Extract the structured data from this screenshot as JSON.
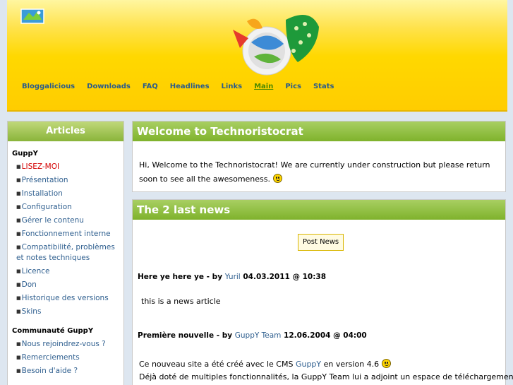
{
  "header": {
    "nav": [
      "Bloggalicious",
      "Downloads",
      "FAQ",
      "Headlines",
      "Links",
      "Main",
      "Pics",
      "Stats"
    ],
    "active_nav": "Main"
  },
  "sidebar": {
    "title": "Articles",
    "sections": [
      {
        "title": "GuppY",
        "items": [
          "LISEZ-MOI",
          "Présentation",
          "Installation",
          "Configuration",
          "Gérer le contenu",
          "Fonctionnement interne",
          "Compatibilité, problèmes et notes techniques",
          "Licence",
          "Don",
          "Historique des versions",
          "Skins"
        ]
      },
      {
        "title": "Communauté GuppY",
        "items": [
          "Nous rejoindrez-vous ?",
          "Remerciements",
          "Besoin d'aide ?"
        ]
      }
    ]
  },
  "welcome": {
    "title": "Welcome to Technoristocrat",
    "text": "Hi, Welcome to the Technoristocrat! We are currently under construction but please return soon to see all the awesomeness."
  },
  "news": {
    "title": "The 2 last news",
    "post_button": "Post News",
    "items": [
      {
        "headline": "Here ye here ye - by",
        "author": "Yuril",
        "date": "04.03.2011 @ 10:38",
        "body": "this is a news article"
      },
      {
        "headline": "Première nouvelle - by",
        "author": "GuppY Team",
        "date": "12.06.2004 @ 04:00",
        "body_pre": "Ce nouveau site a été créé avec le CMS",
        "body_link": "GuppY",
        "body_post": "en version 4.6",
        "body_line2": "Déjà doté de multiples fonctionnalités, la GuppY Team lui a adjoint un espace de téléchargement afin"
      }
    ]
  },
  "colors": {
    "header_yellow": "#ffd800",
    "title_green": "#8ab43a",
    "link_blue": "#2f5f8f",
    "active_nav": "#4e8a00"
  }
}
